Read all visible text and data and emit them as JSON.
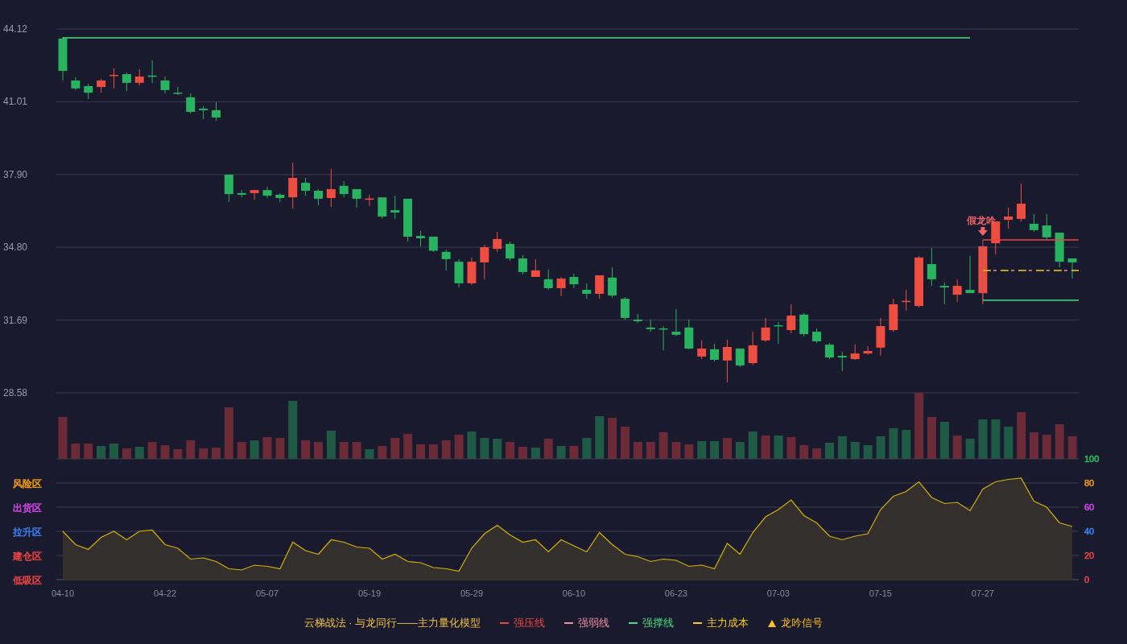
{
  "price_chart": {
    "chart_data": {
      "type": "candlestick",
      "grid": true,
      "ylim": [
        28.58,
        44.12
      ],
      "yticks": [
        {
          "value": 44.12,
          "label": "44.12"
        },
        {
          "value": 41.01,
          "label": "41.01"
        },
        {
          "value": 37.9,
          "label": "37.90"
        },
        {
          "value": 34.8,
          "label": "34.80"
        },
        {
          "value": 31.69,
          "label": "31.69"
        },
        {
          "value": 28.58,
          "label": "28.58"
        }
      ],
      "categories": [
        null,
        null,
        null,
        null,
        null,
        null,
        null,
        null,
        null,
        null,
        null,
        null,
        null,
        null,
        null,
        null,
        null,
        null,
        null,
        null,
        null,
        null,
        null,
        null,
        null,
        null,
        null,
        null,
        null,
        null,
        null,
        null,
        null,
        null,
        null,
        null,
        null,
        null,
        null,
        null,
        null,
        null,
        null,
        null,
        null,
        null,
        null,
        null,
        null,
        null,
        null,
        null,
        null,
        null,
        null,
        null,
        null,
        null,
        null,
        null,
        null,
        null,
        null,
        null,
        null,
        null,
        null,
        null,
        null,
        null,
        null,
        null,
        null,
        null,
        null,
        null,
        null,
        null,
        null,
        null
      ],
      "ohlc": [
        [
          43.71,
          43.78,
          41.92,
          42.33
        ],
        [
          41.92,
          42.06,
          41.51,
          41.58
        ],
        [
          41.68,
          41.78,
          41.13,
          41.4
        ],
        [
          41.64,
          41.99,
          41.4,
          41.92
        ],
        [
          42.15,
          42.44,
          41.58,
          42.16
        ],
        [
          42.19,
          42.26,
          41.47,
          41.82
        ],
        [
          41.82,
          42.4,
          41.71,
          42.09
        ],
        [
          42.13,
          42.78,
          41.82,
          42.12
        ],
        [
          41.92,
          42.09,
          41.37,
          41.51
        ],
        [
          41.4,
          41.64,
          41.3,
          41.39
        ],
        [
          41.2,
          41.37,
          40.51,
          40.58
        ],
        [
          40.72,
          40.82,
          40.27,
          40.65
        ],
        [
          40.65,
          40.99,
          40.2,
          40.34
        ],
        [
          37.9,
          37.9,
          36.73,
          37.07
        ],
        [
          37.11,
          37.24,
          36.93,
          37.04
        ],
        [
          37.11,
          37.24,
          36.83,
          37.24
        ],
        [
          37.24,
          37.38,
          36.9,
          37.0
        ],
        [
          37.04,
          37.11,
          36.73,
          36.9
        ],
        [
          36.93,
          38.41,
          36.45,
          37.76
        ],
        [
          37.55,
          37.76,
          37.0,
          37.21
        ],
        [
          37.21,
          37.28,
          36.59,
          36.87
        ],
        [
          36.9,
          38.14,
          36.52,
          37.28
        ],
        [
          37.42,
          37.62,
          36.93,
          37.07
        ],
        [
          37.28,
          37.28,
          36.49,
          36.87
        ],
        [
          36.87,
          37.04,
          36.56,
          36.88
        ],
        [
          36.93,
          36.93,
          36.01,
          36.11
        ],
        [
          36.38,
          37.0,
          36.01,
          36.28
        ],
        [
          36.87,
          36.87,
          35.04,
          35.25
        ],
        [
          35.28,
          35.49,
          34.84,
          35.18
        ],
        [
          35.25,
          35.25,
          34.6,
          34.65
        ],
        [
          34.6,
          34.7,
          33.81,
          34.29
        ],
        [
          34.18,
          34.29,
          33.08,
          33.26
        ],
        [
          33.26,
          34.36,
          33.19,
          34.18
        ],
        [
          34.15,
          34.91,
          33.43,
          34.8
        ],
        [
          34.73,
          35.46,
          34.6,
          35.15
        ],
        [
          34.94,
          35.04,
          34.22,
          34.32
        ],
        [
          34.32,
          34.46,
          33.63,
          33.74
        ],
        [
          33.53,
          34.29,
          33.53,
          33.81
        ],
        [
          33.43,
          33.84,
          32.98,
          33.05
        ],
        [
          33.05,
          33.53,
          32.71,
          33.46
        ],
        [
          33.53,
          33.67,
          33.05,
          33.22
        ],
        [
          32.98,
          33.26,
          32.6,
          32.81
        ],
        [
          32.81,
          33.6,
          32.6,
          33.6
        ],
        [
          33.5,
          33.94,
          32.64,
          32.74
        ],
        [
          32.6,
          32.67,
          31.71,
          31.78
        ],
        [
          31.71,
          31.95,
          31.57,
          31.64
        ],
        [
          31.37,
          31.71,
          31.19,
          31.3
        ],
        [
          31.33,
          31.43,
          30.4,
          31.32
        ],
        [
          31.19,
          32.16,
          30.99,
          31.06
        ],
        [
          31.37,
          31.71,
          30.44,
          30.47
        ],
        [
          30.13,
          30.82,
          30.02,
          30.47
        ],
        [
          30.44,
          30.68,
          29.92,
          29.99
        ],
        [
          29.96,
          30.85,
          29.03,
          30.54
        ],
        [
          30.47,
          30.47,
          29.68,
          29.75
        ],
        [
          29.85,
          31.19,
          29.78,
          30.61
        ],
        [
          30.82,
          31.78,
          30.75,
          31.37
        ],
        [
          31.47,
          31.61,
          30.68,
          31.46
        ],
        [
          31.26,
          32.36,
          31.12,
          31.88
        ],
        [
          31.92,
          31.98,
          30.99,
          31.09
        ],
        [
          31.19,
          31.33,
          30.71,
          30.78
        ],
        [
          30.64,
          30.71,
          30.02,
          30.09
        ],
        [
          30.16,
          30.33,
          29.51,
          30.09
        ],
        [
          30.02,
          30.64,
          29.99,
          30.26
        ],
        [
          30.26,
          30.57,
          30.2,
          30.37
        ],
        [
          30.51,
          31.78,
          30.16,
          31.43
        ],
        [
          31.26,
          32.6,
          31.19,
          32.36
        ],
        [
          32.5,
          32.98,
          32.09,
          32.51
        ],
        [
          32.29,
          34.43,
          32.22,
          34.36
        ],
        [
          34.08,
          34.77,
          33.15,
          33.43
        ],
        [
          33.15,
          33.29,
          32.36,
          33.08
        ],
        [
          32.77,
          33.43,
          32.47,
          33.15
        ],
        [
          32.98,
          34.43,
          32.84,
          32.84
        ],
        [
          32.84,
          34.84,
          32.36,
          34.84
        ],
        [
          34.97,
          35.9,
          34.49,
          35.9
        ],
        [
          35.97,
          36.49,
          35.59,
          36.11
        ],
        [
          36.01,
          37.52,
          35.9,
          36.66
        ],
        [
          35.8,
          36.21,
          35.46,
          35.53
        ],
        [
          35.73,
          36.21,
          35.15,
          35.22
        ],
        [
          35.42,
          35.42,
          33.94,
          34.18
        ],
        [
          34.32,
          34.32,
          33.46,
          34.15
        ]
      ],
      "annotations": [
        "假龙吟"
      ]
    }
  },
  "oscillator": {
    "chart_data": {
      "type": "area",
      "grid": true,
      "ylim": [
        0,
        100
      ],
      "yticks": [
        0,
        20,
        40,
        60,
        80,
        100
      ],
      "categories": [
        "04-10",
        null,
        null,
        null,
        null,
        null,
        null,
        null,
        "04-22",
        null,
        null,
        null,
        null,
        null,
        null,
        null,
        "05-07",
        null,
        null,
        null,
        null,
        null,
        null,
        null,
        "05-19",
        null,
        null,
        null,
        null,
        null,
        null,
        null,
        "05-29",
        null,
        null,
        null,
        null,
        null,
        null,
        null,
        "06-10",
        null,
        null,
        null,
        null,
        null,
        null,
        null,
        "06-23",
        null,
        null,
        null,
        null,
        null,
        null,
        null,
        "07-03",
        null,
        null,
        null,
        null,
        null,
        null,
        null,
        "07-15",
        null,
        null,
        null,
        null,
        null,
        null,
        null,
        "07-27",
        null,
        null,
        null,
        null,
        null,
        null,
        null
      ],
      "series": [
        {
          "color": "#d4b106",
          "values": [
            40,
            29,
            25,
            35,
            40,
            33,
            40,
            41,
            29,
            26,
            17,
            18,
            15,
            9,
            8,
            12,
            11,
            9,
            31,
            24,
            21,
            33,
            31,
            27,
            26,
            17,
            21,
            15,
            14,
            10,
            9,
            7,
            26,
            38,
            45,
            37,
            31,
            33,
            23,
            33,
            28,
            23,
            39,
            29,
            21,
            19,
            15,
            17,
            16,
            11,
            12,
            9,
            30,
            21,
            39,
            52,
            58,
            66,
            53,
            47,
            36,
            33,
            36,
            38,
            58,
            69,
            73,
            81,
            68,
            63,
            64,
            57,
            75,
            81,
            83,
            84,
            65,
            60,
            47,
            44
          ]
        }
      ]
    },
    "tick_styles": [
      {
        "color": "#ef4444"
      },
      {
        "color": "#ef4444"
      },
      {
        "color": "#3b82f6"
      },
      {
        "color": "#d946ef"
      },
      {
        "color": "#f59e0b"
      },
      {
        "color": "#22c55e"
      }
    ],
    "zones": [
      {
        "label": "风险区",
        "color": "#f59e0b"
      },
      {
        "label": "出货区",
        "color": "#d946ef"
      },
      {
        "label": "拉升区",
        "color": "#3b82f6"
      },
      {
        "label": "建仓区",
        "color": "#ef4444"
      },
      {
        "label": "低吸区",
        "color": "#ef4444"
      }
    ]
  },
  "legend": {
    "title": "云梯战法 · 与龙同行——主力量化模型",
    "items": [
      {
        "kind": "solid",
        "color": "#ef4444",
        "label": "强压线"
      },
      {
        "kind": "dashed",
        "color": "#f48fa0",
        "label": "强弱线"
      },
      {
        "kind": "solid",
        "color": "#4ade80",
        "label": "强撑线"
      },
      {
        "kind": "dashed",
        "color": "#facc15",
        "label": "主力成本"
      },
      {
        "kind": "triangle",
        "color": "#fbbf24",
        "label": "龙吟信号"
      }
    ]
  }
}
